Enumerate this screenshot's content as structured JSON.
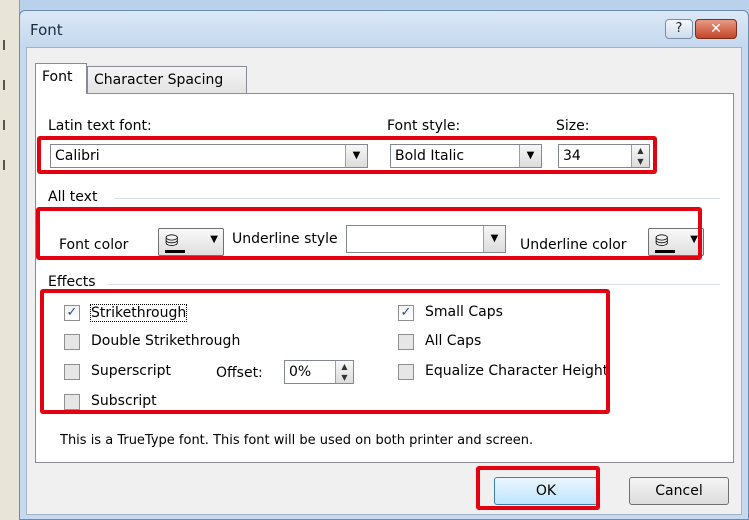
{
  "dialog": {
    "title": "Font",
    "help_label": "?",
    "close_label": "✕"
  },
  "tabs": [
    {
      "label": "Font"
    },
    {
      "label": "Character Spacing"
    }
  ],
  "font_section": {
    "latin_label": "Latin text font:",
    "latin_value": "Calibri",
    "style_label": "Font style:",
    "style_value": "Bold Italic",
    "size_label": "Size:",
    "size_value": "34"
  },
  "all_text": {
    "header": "All text",
    "font_color_label": "Font color",
    "underline_style_label": "Underline style",
    "underline_style_value": "",
    "underline_color_label": "Underline color"
  },
  "effects": {
    "header": "Effects",
    "strikethrough": {
      "label": "Strikethrough",
      "checked": true
    },
    "double_strikethrough": {
      "label": "Double Strikethrough",
      "checked": false
    },
    "superscript": {
      "label": "Superscript",
      "checked": false
    },
    "subscript": {
      "label": "Subscript",
      "checked": false
    },
    "offset_label": "Offset:",
    "offset_value": "0%",
    "small_caps": {
      "label": "Small Caps",
      "checked": true
    },
    "all_caps": {
      "label": "All Caps",
      "checked": false
    },
    "equalize_height": {
      "label": "Equalize Character Height",
      "checked": false
    }
  },
  "info_text": "This is a TrueType font. This font will be used on both printer and screen.",
  "buttons": {
    "ok": "OK",
    "cancel": "Cancel"
  },
  "colors": {
    "highlight": "#e3000f",
    "title_bar": "#c4d8ee",
    "close": "#c4452b"
  },
  "icons": {
    "font_color": "paint-bucket-icon",
    "underline_color": "paint-bucket-icon",
    "dropdown": "chevron-down-icon",
    "check": "checkmark-icon"
  }
}
